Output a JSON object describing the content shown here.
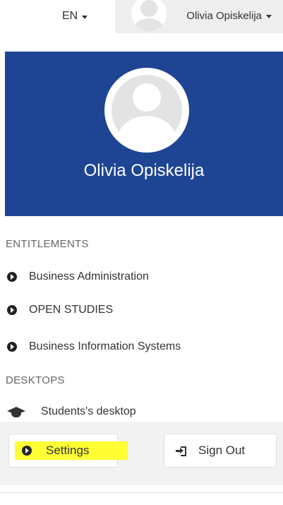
{
  "topbar": {
    "language": "EN",
    "user_name": "Olivia Opiskelija"
  },
  "profile": {
    "name": "Olivia Opiskelija"
  },
  "entitlements": {
    "header": "ENTITLEMENTS",
    "items": [
      {
        "label": "Business Administration",
        "icon": "circle-arrow-right-icon"
      },
      {
        "label": "OPEN STUDIES",
        "icon": "circle-arrow-right-icon"
      },
      {
        "label": "Business Information Systems",
        "icon": "circle-arrow-right-icon"
      }
    ]
  },
  "desktops": {
    "header": "DESKTOPS",
    "items": [
      {
        "label": "Students's desktop",
        "icon": "graduation-cap-icon"
      }
    ]
  },
  "actions": {
    "settings_label": "Settings",
    "signout_label": "Sign Out",
    "highlight_color": "#ffff33"
  },
  "colors": {
    "brand": "#1e4594",
    "text": "#333333",
    "muted": "#666666"
  }
}
